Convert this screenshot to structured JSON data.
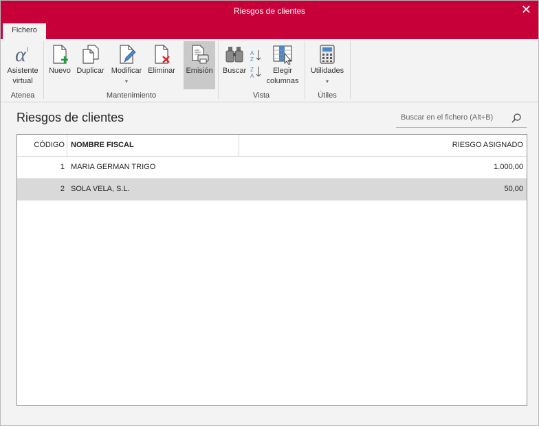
{
  "window": {
    "title": "Riesgos de clientes",
    "close_glyph": "✕",
    "accent_color": "#c8003a"
  },
  "ribbon": {
    "tab_label": "Fichero",
    "buttons": {
      "asistente": {
        "line1": "Asistente",
        "line2": "virtual",
        "icon": "alpha-icon"
      },
      "nuevo": {
        "label": "Nuevo",
        "icon": "new-document-icon"
      },
      "duplicar": {
        "label": "Duplicar",
        "icon": "duplicate-icon"
      },
      "modificar": {
        "label": "Modificar",
        "icon": "edit-document-icon",
        "arrow": "▾"
      },
      "eliminar": {
        "label": "Eliminar",
        "icon": "delete-document-icon"
      },
      "emision": {
        "label": "Emisión",
        "icon": "print-icon"
      },
      "buscar": {
        "label": "Buscar",
        "icon": "binoculars-icon"
      },
      "elegir": {
        "line1": "Elegir",
        "line2": "columnas",
        "icon": "columns-icon"
      },
      "utilidades": {
        "label": "Utilidades",
        "icon": "calculator-icon",
        "arrow": "▾"
      }
    },
    "groups": {
      "atenea": "Atenea",
      "mantenimiento": "Mantenimiento",
      "vista": "Vista",
      "utiles": "Útiles"
    }
  },
  "main": {
    "page_title": "Riesgos de clientes",
    "search_placeholder": "Buscar en el fichero (Alt+B)",
    "columns": {
      "codigo": "CÓDIGO",
      "nombre": "NOMBRE FISCAL",
      "riesgo": "RIESGO ASIGNADO"
    },
    "rows": [
      {
        "codigo": "1",
        "nombre": "MARIA GERMAN TRIGO",
        "riesgo": "1.000,00"
      },
      {
        "codigo": "2",
        "nombre": "SOLA VELA, S.L.",
        "riesgo": "50,00"
      }
    ]
  }
}
